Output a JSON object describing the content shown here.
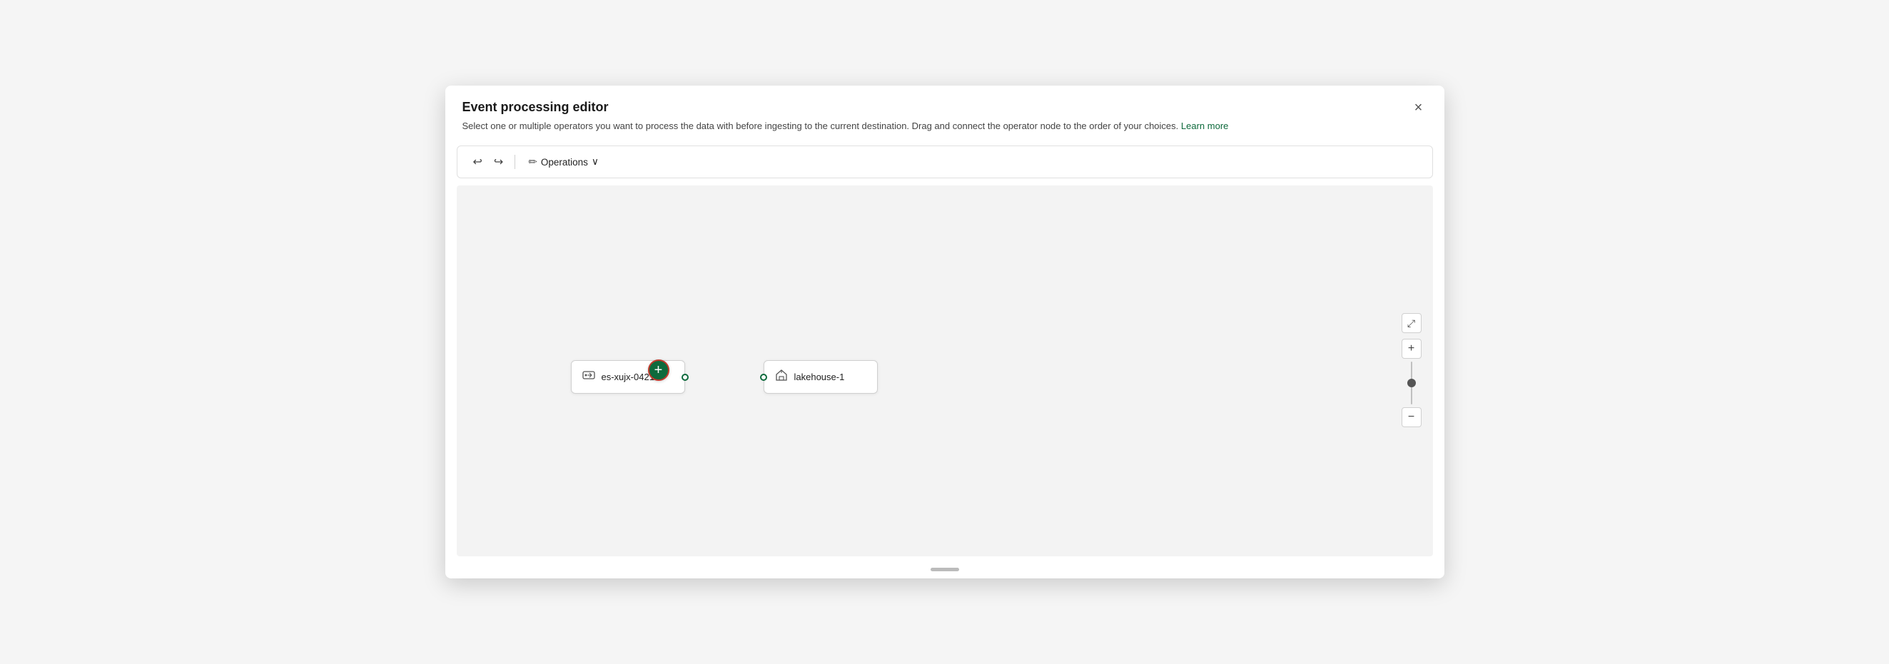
{
  "dialog": {
    "title": "Event processing editor",
    "subtitle": "Select one or multiple operators you want to process the data with before ingesting to the current destination. Drag and connect the operator node to the order of your choices.",
    "learn_more": "Learn more",
    "close_label": "×"
  },
  "toolbar": {
    "undo_label": "↩",
    "redo_label": "↪",
    "operations_label": "Operations",
    "chevron_label": "∨"
  },
  "canvas": {
    "source_node": {
      "label": "es-xujx-0421"
    },
    "dest_node": {
      "label": "lakehouse-1"
    },
    "add_btn_label": "+"
  },
  "zoom": {
    "fit_icon": "⤢",
    "plus_icon": "+",
    "minus_icon": "−"
  }
}
